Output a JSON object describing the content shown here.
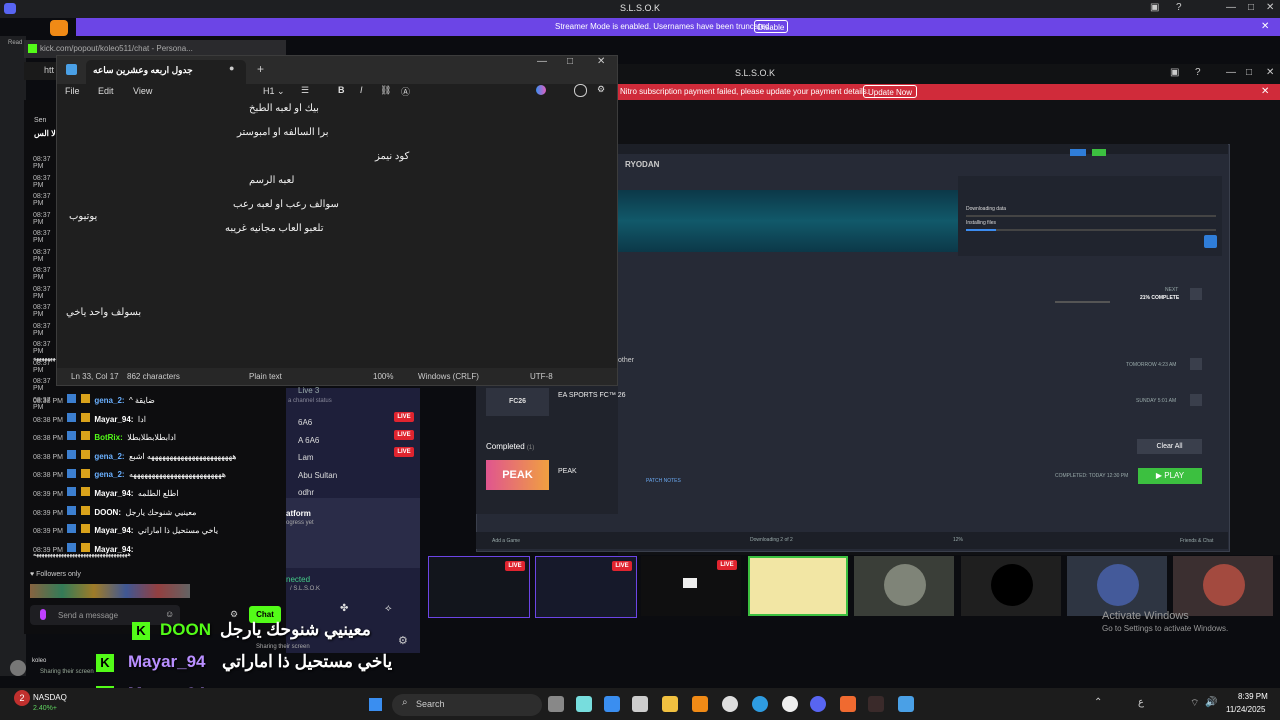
{
  "discord": {
    "title": "S.L.S.O.K",
    "streamer_banner": "Streamer Mode is enabled. Usernames have been truncated.",
    "disable_label": "Disable",
    "inner_title": "S.L.S.O.K",
    "nitro_banner": "Nitro subscription payment failed, please update your payment details.",
    "update_label": "Update Now"
  },
  "browser": {
    "url": "kick.com/popout/koleo511/chat - Persona...",
    "tab_prefix": "htt",
    "read_label": "Read"
  },
  "notepad": {
    "tab_title": "جدول اربعه وعشرين ساعه",
    "add_tab": "+",
    "menu": [
      "File",
      "Edit",
      "View"
    ],
    "heading_label": "H1",
    "lines": [
      "بيك او لعبه الطبخ",
      "برا السالفه او امبوستر",
      "كود نيمز",
      "لعبه الرسم",
      "سوالف رعب او لعبه رعب",
      "تلعبو العاب مجانيه غريبه",
      "يوتيوب",
      "بسولف واحد ياخي"
    ],
    "status": {
      "position": "Ln 33, Col 17",
      "characters": "862 characters",
      "format": "Plain text",
      "zoom": "100%",
      "line_ending": "Windows (CRLF)",
      "encoding": "UTF-8"
    }
  },
  "chat": {
    "header_icon_text": "Sen",
    "header_user": "لا الس",
    "early_timestamps": [
      "08:37 PM",
      "08:37 PM",
      "08:37 PM",
      "08:37 PM",
      "08:37 PM",
      "08:37 PM",
      "08:37 PM",
      "08:37 PM",
      "08:37 PM",
      "08:37 PM",
      "08:37 PM",
      "08:37 PM",
      "08:37 PM",
      "08:37 PM"
    ],
    "messages": [
      {
        "time": "08:38 PM",
        "user": "gena_2:",
        "text": "^ ضايقة"
      },
      {
        "time": "08:38 PM",
        "user": "Mayar_94:",
        "text": "ادا"
      },
      {
        "time": "08:38 PM",
        "user": "BotRix:",
        "text": "ادابطلابطلابطلا"
      },
      {
        "time": "08:38 PM",
        "user": "gena_2:",
        "text": "هههههههههههههههههههههههه اشبع"
      },
      {
        "time": "08:38 PM",
        "user": "gena_2:",
        "text": "هههههههههههههههههههههههههه"
      },
      {
        "time": "08:39 PM",
        "user": "Mayar_94:",
        "text": "اطلع الطلمه"
      },
      {
        "time": "08:39 PM",
        "user": "DOON:",
        "text": "معينيي شنوحك يارجل"
      },
      {
        "time": "08:39 PM",
        "user": "Mayar_94:",
        "text": "ياخي مستحيل ذا اماراتي"
      },
      {
        "time": "08:39 PM",
        "user": "Mayar_94:",
        "text": ""
      }
    ],
    "long_line": "ههههههههههههههههههههههههههههههههههه",
    "followers_only": "Followers only",
    "input_placeholder": "Send a message",
    "chat_button": "Chat"
  },
  "middle": {
    "header": "Live 3",
    "subheader": "a channel status",
    "items": [
      {
        "name": "6A6",
        "live": true
      },
      {
        "name": "A 6A6",
        "live": true
      },
      {
        "name": "Lam",
        "live": true
      },
      {
        "name": "Abu Sultan",
        "live": false
      },
      {
        "name": "odhr",
        "live": false
      }
    ],
    "live_label": "LIVE",
    "platform_title": "atform",
    "platform_sub": "ogress yet",
    "connected_label": "nected",
    "connected_channel": "/ S.L.S.O.K",
    "sharing": "Sharing their screen"
  },
  "launcher": {
    "title": "RYODAN",
    "downloading": "Downloading data",
    "installing": "Installing files",
    "next_label": "NEXT",
    "complete_pct": "21% COMPLETE",
    "ea_title": "EA SPORTS FC™ 26",
    "ea_logo": "FC26",
    "other_label": "other",
    "today": "TOMORROW 4:23 AM",
    "sunday": "SUNDAY 5:01 AM",
    "completed_label": "Completed",
    "completed_count": "(1)",
    "clear_all": "Clear All",
    "peak_title": "PEAK",
    "peak_thumb": "PEAK",
    "patch_notes": "PATCH NOTES",
    "completed_time": "COMPLETED: TODAY 12:30 PM",
    "play_label": "▶ PLAY",
    "downloading_footer": "Downloading 2 of 2",
    "pct_footer": "12%",
    "add_game": "Add a Game",
    "friends": "Friends & Chat"
  },
  "thumbs": {
    "live_label": "LIVE"
  },
  "windows": {
    "activate_title": "Activate Windows",
    "activate_sub": "Go to Settings to activate Windows."
  },
  "overlay": [
    {
      "user": "DOON",
      "text": "معينيي شنوحك يارجل"
    },
    {
      "user": "Mayar_94",
      "text": "ياخي مستحيل ذا اماراتي"
    },
    {
      "user": "Mayar_94",
      "text": "هههههههههههههههههههههههههههههههههههههههههههههه"
    }
  ],
  "overlay_side": {
    "user": "koleo",
    "status": "Sharing their screen"
  },
  "taskbar": {
    "stock_name": "NASDAQ",
    "stock_change": "2.40%+",
    "search": "Search",
    "time": "8:39 PM",
    "date": "11/24/2025",
    "lang": "ع",
    "badge_count": "2"
  },
  "colors": {
    "discord_purple": "#6c45e6",
    "nitro_red": "#d02b3a",
    "kick_green": "#53fc18",
    "live_red": "#e0242f",
    "play_green": "#3cc040"
  }
}
